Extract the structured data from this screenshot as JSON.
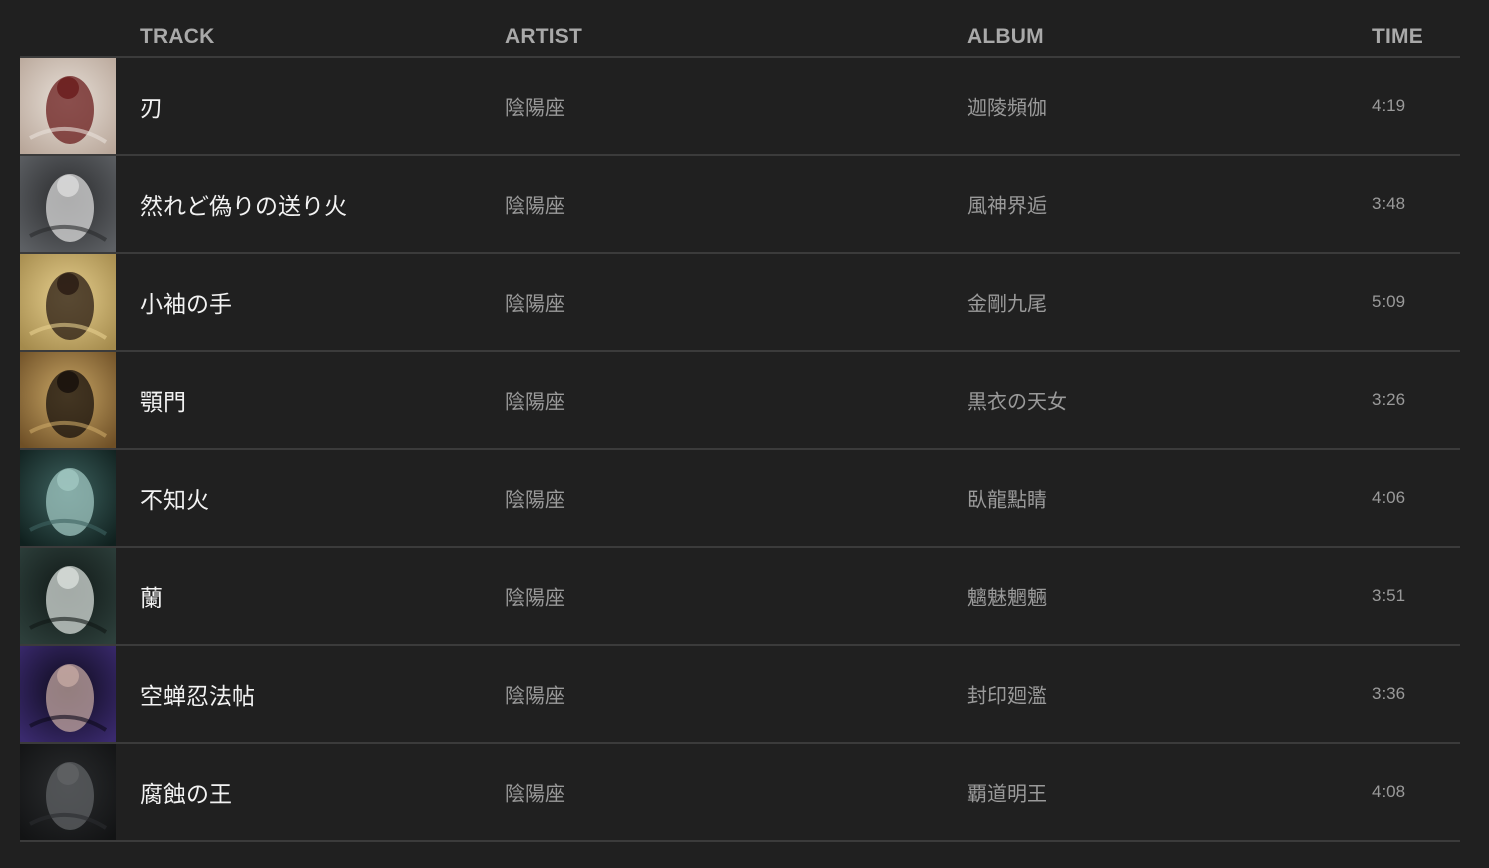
{
  "header": {
    "track": "TRACK",
    "artist": "ARTIST",
    "album": "ALBUM",
    "time": "TIME"
  },
  "rows": [
    {
      "track": "刃",
      "artist": "陰陽座",
      "album": "迦陵頻伽",
      "time": "4:19",
      "art": {
        "bg": "#b9a79a",
        "fg": "#6b1d1d",
        "accent": "#e8e0d8"
      }
    },
    {
      "track": "然れど偽りの送り火",
      "artist": "陰陽座",
      "album": "風神界逅",
      "time": "3:48",
      "art": {
        "bg": "#5d6064",
        "fg": "#d9d9d9",
        "accent": "#2a2b2d"
      }
    },
    {
      "track": "小袖の手",
      "artist": "陰陽座",
      "album": "金剛九尾",
      "time": "5:09",
      "art": {
        "bg": "#a48a4c",
        "fg": "#2a1c14",
        "accent": "#e6cf8e"
      }
    },
    {
      "track": "顎門",
      "artist": "陰陽座",
      "album": "黒衣の天女",
      "time": "3:26",
      "art": {
        "bg": "#6e4f26",
        "fg": "#17100c",
        "accent": "#c9a766"
      }
    },
    {
      "track": "不知火",
      "artist": "陰陽座",
      "album": "臥龍點睛",
      "time": "4:06",
      "art": {
        "bg": "#10201e",
        "fg": "#9fc6c0",
        "accent": "#3e6360"
      }
    },
    {
      "track": "蘭",
      "artist": "陰陽座",
      "album": "魑魅魍魎",
      "time": "3:51",
      "art": {
        "bg": "#2d3f3b",
        "fg": "#d6dcd8",
        "accent": "#101816"
      }
    },
    {
      "track": "空蝉忍法帖",
      "artist": "陰陽座",
      "album": "封印廻濫",
      "time": "3:36",
      "art": {
        "bg": "#3a2a6e",
        "fg": "#c2a6a0",
        "accent": "#0d0a1a"
      }
    },
    {
      "track": "腐蝕の王",
      "artist": "陰陽座",
      "album": "覇道明王",
      "time": "4:08",
      "art": {
        "bg": "#121314",
        "fg": "#5f6164",
        "accent": "#2a2c2e"
      }
    }
  ]
}
